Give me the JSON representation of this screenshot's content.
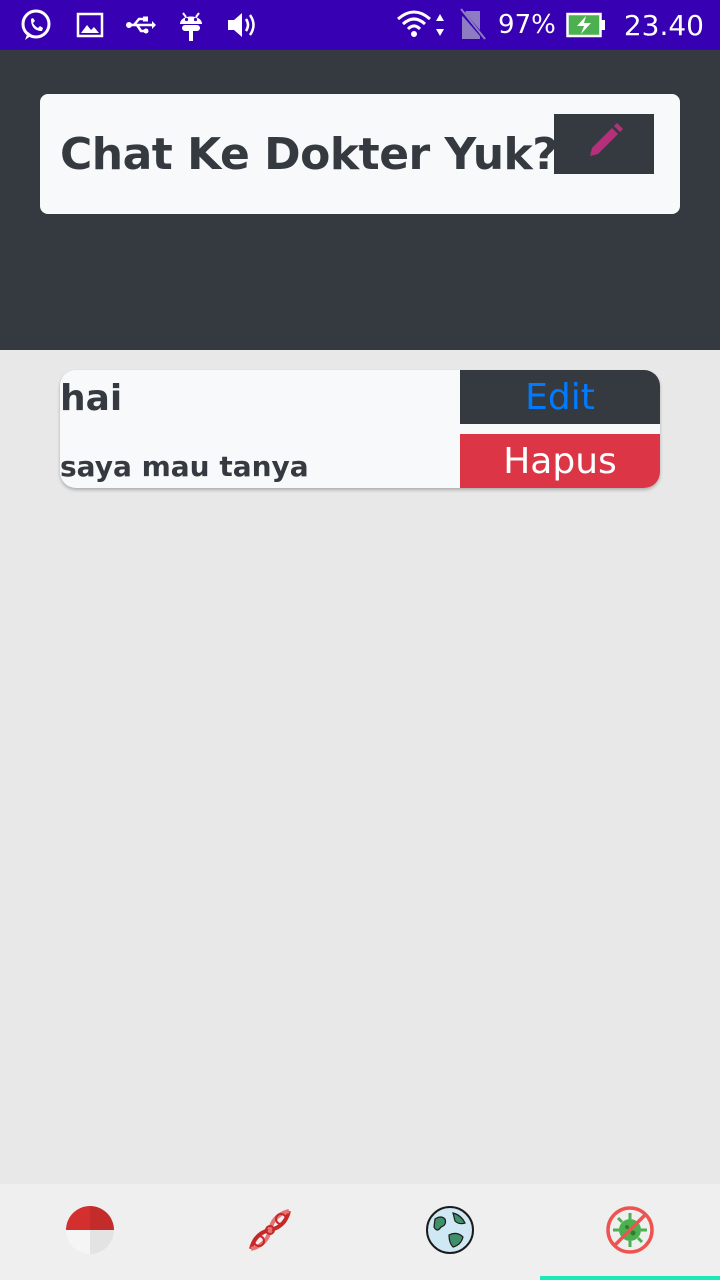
{
  "status_bar": {
    "battery": "97%",
    "time": "23.40",
    "icons": [
      "whatsapp-icon",
      "gallery-icon",
      "usb-icon",
      "android-icon",
      "volume-icon",
      "wifi-icon",
      "no-sim-icon",
      "battery-charging-icon"
    ]
  },
  "header": {
    "title": "Chat Ke Dokter Yuk?",
    "new_chat_icon": "pencil-icon",
    "accent_color": "#b5307a"
  },
  "chats": [
    {
      "title": "hai",
      "message": "saya mau tanya",
      "edit_label": "Edit",
      "delete_label": "Hapus"
    }
  ],
  "bottom_nav": {
    "items": [
      {
        "icon": "indonesia-flag-icon",
        "active": false
      },
      {
        "icon": "virus-dna-icon",
        "active": false
      },
      {
        "icon": "globe-icon",
        "active": false
      },
      {
        "icon": "no-virus-icon",
        "active": true
      }
    ]
  },
  "colors": {
    "status_bar": "#3700b3",
    "header_bg": "#343a40",
    "card_bg": "#f8f9fa",
    "edit_text": "#007bff",
    "delete_bg": "#dc3545",
    "nav_indicator": "#1de9b6"
  }
}
